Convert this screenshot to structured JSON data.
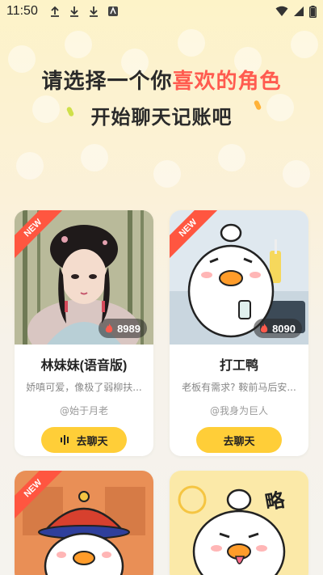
{
  "status_bar": {
    "time": "11:50"
  },
  "header": {
    "line1_prefix": "请选择一个你",
    "line1_accent": "喜欢的角色",
    "line2": "开始聊天记账吧"
  },
  "colors": {
    "accent": "#ff5b4f",
    "button": "#ffce38",
    "badge": "#ff5640"
  },
  "cards": [
    {
      "badge": "NEW",
      "count": "8989",
      "title": "林妹妹(语音版)",
      "desc": "娇嗔可爱，像极了弱柳扶...",
      "author": "@始于月老",
      "button_label": "去聊天",
      "has_voice_icon": true
    },
    {
      "badge": "NEW",
      "count": "8090",
      "title": "打工鸭",
      "desc": "老板有需求? 鞍前马后安...",
      "author": "@我身为巨人",
      "button_label": "去聊天",
      "has_voice_icon": false
    },
    {
      "badge": "NEW"
    },
    {
      "sign_text": "略"
    }
  ]
}
